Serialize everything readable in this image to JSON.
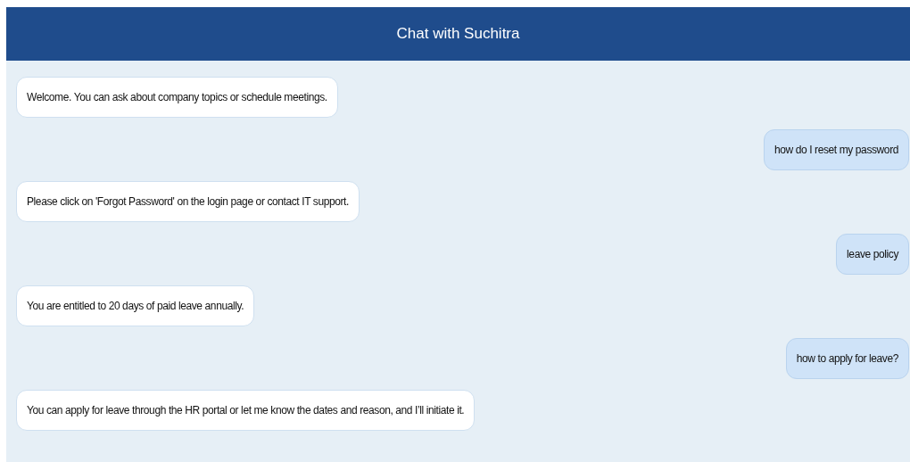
{
  "header": {
    "title": "Chat with Suchitra"
  },
  "messages": [
    {
      "kind": "bot",
      "text": "Welcome. You can ask about company topics or schedule meetings."
    },
    {
      "kind": "user",
      "text": "how do I reset my password"
    },
    {
      "kind": "bot",
      "text": "Please click on 'Forgot Password' on the login page or contact IT support."
    },
    {
      "kind": "user",
      "text": "leave policy"
    },
    {
      "kind": "bot",
      "text": "You are entitled to 20 days of paid leave annually."
    },
    {
      "kind": "user",
      "text": "how to apply for leave?"
    },
    {
      "kind": "bot",
      "text": "You can apply for leave through the HR portal or let me know the dates and reason, and I’ll initiate it."
    }
  ]
}
